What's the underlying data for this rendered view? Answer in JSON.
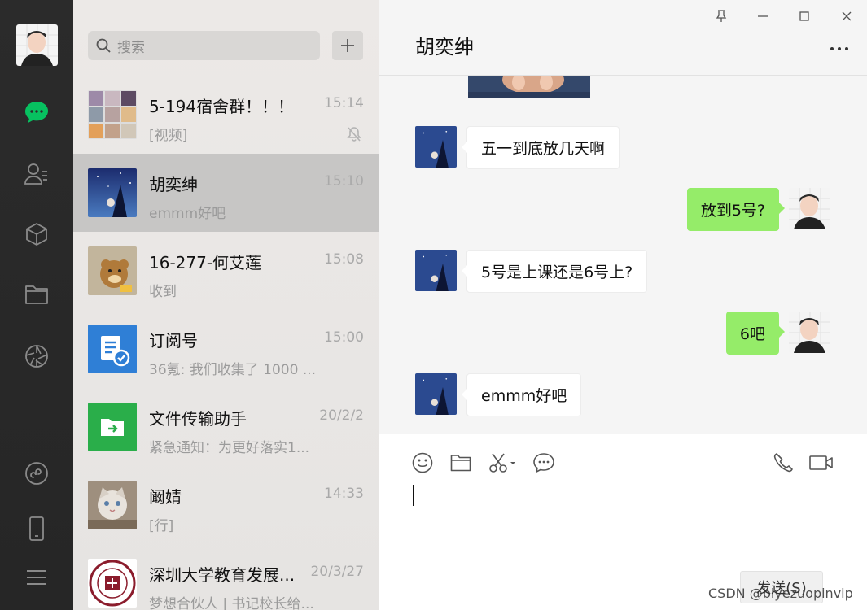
{
  "search": {
    "placeholder": "搜索"
  },
  "conversations": [
    {
      "name": "5-194宿舍群！！！",
      "time": "15:14",
      "preview": "[视频]",
      "muted": true
    },
    {
      "name": "胡奕绅",
      "time": "15:10",
      "preview": "emmm好吧",
      "active": true
    },
    {
      "name": "16-277-何艾莲",
      "time": "15:08",
      "preview": "收到"
    },
    {
      "name": "订阅号",
      "time": "15:00",
      "preview": "36氪: 我们收集了 1000 ..."
    },
    {
      "name": "文件传输助手",
      "time": "20/2/2",
      "preview": "紧急通知：为更好落实1..."
    },
    {
      "name": "阚婧",
      "time": "14:33",
      "preview": "[行]"
    },
    {
      "name": "深圳大学教育发展...",
      "time": "20/3/27",
      "preview": "梦想合伙人 | 书记校长给..."
    }
  ],
  "chat": {
    "title": "胡奕绅",
    "messages": [
      {
        "from": "other",
        "text": "五一到底放几天啊"
      },
      {
        "from": "me",
        "text": "放到5号?"
      },
      {
        "from": "other",
        "text": "5号是上课还是6号上?"
      },
      {
        "from": "me",
        "text": "6吧"
      },
      {
        "from": "other",
        "text": "emmm好吧"
      }
    ],
    "send_label": "发送(S)"
  },
  "watermark": "CSDN @biyezuopinvip",
  "colors": {
    "accent": "#07c160",
    "bubble_out": "#95ec69",
    "nav_bg": "#2b2b2b"
  }
}
